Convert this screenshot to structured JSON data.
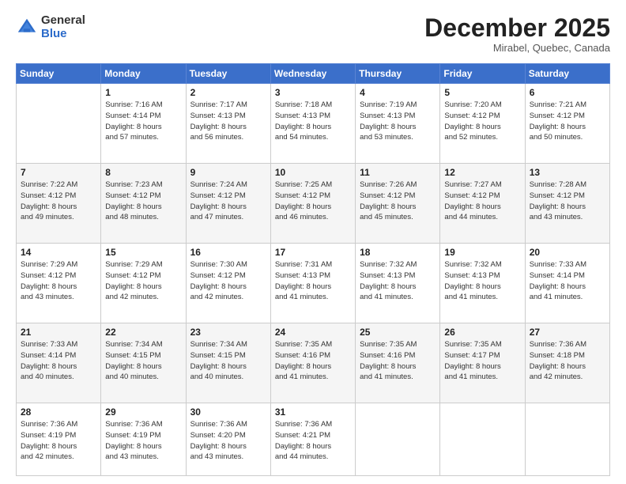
{
  "header": {
    "logo_general": "General",
    "logo_blue": "Blue",
    "month_title": "December 2025",
    "location": "Mirabel, Quebec, Canada"
  },
  "days_of_week": [
    "Sunday",
    "Monday",
    "Tuesday",
    "Wednesday",
    "Thursday",
    "Friday",
    "Saturday"
  ],
  "weeks": [
    [
      {
        "day": "",
        "info": ""
      },
      {
        "day": "1",
        "info": "Sunrise: 7:16 AM\nSunset: 4:14 PM\nDaylight: 8 hours\nand 57 minutes."
      },
      {
        "day": "2",
        "info": "Sunrise: 7:17 AM\nSunset: 4:13 PM\nDaylight: 8 hours\nand 56 minutes."
      },
      {
        "day": "3",
        "info": "Sunrise: 7:18 AM\nSunset: 4:13 PM\nDaylight: 8 hours\nand 54 minutes."
      },
      {
        "day": "4",
        "info": "Sunrise: 7:19 AM\nSunset: 4:13 PM\nDaylight: 8 hours\nand 53 minutes."
      },
      {
        "day": "5",
        "info": "Sunrise: 7:20 AM\nSunset: 4:12 PM\nDaylight: 8 hours\nand 52 minutes."
      },
      {
        "day": "6",
        "info": "Sunrise: 7:21 AM\nSunset: 4:12 PM\nDaylight: 8 hours\nand 50 minutes."
      }
    ],
    [
      {
        "day": "7",
        "info": "Sunrise: 7:22 AM\nSunset: 4:12 PM\nDaylight: 8 hours\nand 49 minutes."
      },
      {
        "day": "8",
        "info": "Sunrise: 7:23 AM\nSunset: 4:12 PM\nDaylight: 8 hours\nand 48 minutes."
      },
      {
        "day": "9",
        "info": "Sunrise: 7:24 AM\nSunset: 4:12 PM\nDaylight: 8 hours\nand 47 minutes."
      },
      {
        "day": "10",
        "info": "Sunrise: 7:25 AM\nSunset: 4:12 PM\nDaylight: 8 hours\nand 46 minutes."
      },
      {
        "day": "11",
        "info": "Sunrise: 7:26 AM\nSunset: 4:12 PM\nDaylight: 8 hours\nand 45 minutes."
      },
      {
        "day": "12",
        "info": "Sunrise: 7:27 AM\nSunset: 4:12 PM\nDaylight: 8 hours\nand 44 minutes."
      },
      {
        "day": "13",
        "info": "Sunrise: 7:28 AM\nSunset: 4:12 PM\nDaylight: 8 hours\nand 43 minutes."
      }
    ],
    [
      {
        "day": "14",
        "info": "Sunrise: 7:29 AM\nSunset: 4:12 PM\nDaylight: 8 hours\nand 43 minutes."
      },
      {
        "day": "15",
        "info": "Sunrise: 7:29 AM\nSunset: 4:12 PM\nDaylight: 8 hours\nand 42 minutes."
      },
      {
        "day": "16",
        "info": "Sunrise: 7:30 AM\nSunset: 4:12 PM\nDaylight: 8 hours\nand 42 minutes."
      },
      {
        "day": "17",
        "info": "Sunrise: 7:31 AM\nSunset: 4:13 PM\nDaylight: 8 hours\nand 41 minutes."
      },
      {
        "day": "18",
        "info": "Sunrise: 7:32 AM\nSunset: 4:13 PM\nDaylight: 8 hours\nand 41 minutes."
      },
      {
        "day": "19",
        "info": "Sunrise: 7:32 AM\nSunset: 4:13 PM\nDaylight: 8 hours\nand 41 minutes."
      },
      {
        "day": "20",
        "info": "Sunrise: 7:33 AM\nSunset: 4:14 PM\nDaylight: 8 hours\nand 41 minutes."
      }
    ],
    [
      {
        "day": "21",
        "info": "Sunrise: 7:33 AM\nSunset: 4:14 PM\nDaylight: 8 hours\nand 40 minutes."
      },
      {
        "day": "22",
        "info": "Sunrise: 7:34 AM\nSunset: 4:15 PM\nDaylight: 8 hours\nand 40 minutes."
      },
      {
        "day": "23",
        "info": "Sunrise: 7:34 AM\nSunset: 4:15 PM\nDaylight: 8 hours\nand 40 minutes."
      },
      {
        "day": "24",
        "info": "Sunrise: 7:35 AM\nSunset: 4:16 PM\nDaylight: 8 hours\nand 41 minutes."
      },
      {
        "day": "25",
        "info": "Sunrise: 7:35 AM\nSunset: 4:16 PM\nDaylight: 8 hours\nand 41 minutes."
      },
      {
        "day": "26",
        "info": "Sunrise: 7:35 AM\nSunset: 4:17 PM\nDaylight: 8 hours\nand 41 minutes."
      },
      {
        "day": "27",
        "info": "Sunrise: 7:36 AM\nSunset: 4:18 PM\nDaylight: 8 hours\nand 42 minutes."
      }
    ],
    [
      {
        "day": "28",
        "info": "Sunrise: 7:36 AM\nSunset: 4:19 PM\nDaylight: 8 hours\nand 42 minutes."
      },
      {
        "day": "29",
        "info": "Sunrise: 7:36 AM\nSunset: 4:19 PM\nDaylight: 8 hours\nand 43 minutes."
      },
      {
        "day": "30",
        "info": "Sunrise: 7:36 AM\nSunset: 4:20 PM\nDaylight: 8 hours\nand 43 minutes."
      },
      {
        "day": "31",
        "info": "Sunrise: 7:36 AM\nSunset: 4:21 PM\nDaylight: 8 hours\nand 44 minutes."
      },
      {
        "day": "",
        "info": ""
      },
      {
        "day": "",
        "info": ""
      },
      {
        "day": "",
        "info": ""
      }
    ]
  ]
}
